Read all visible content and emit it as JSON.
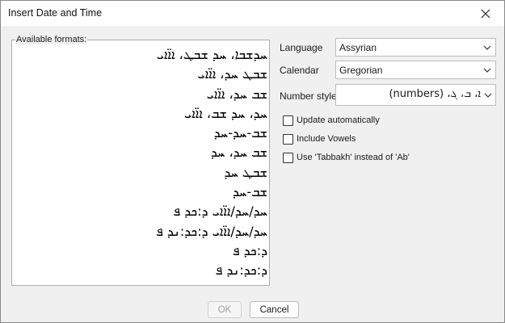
{
  "window": {
    "title": "Insert Date and Time"
  },
  "formats": {
    "label": "Available formats:",
    "items": [
      "ܚܕܫܒܐ، ܚܕ ܫܒܛ، ܐܐ̈ܐܝ",
      "ܫܒܛ ܚܕ، ܐܐ̈ܐܝ",
      "ܫܒ ܚܕ، ܐܐ̈ܐܝ",
      "ܚܕ، ܚܕ ܫܒ، ܐܐ̈ܐܝ",
      "ܫܒ-ܚܕ-ܚܕ",
      "ܫܒ ܚܕ، ܚܕ",
      "ܫܒܛ ܚܕ",
      "ܫܒ-ܚܕ",
      "ܚܕ/ܚܕ/ܐܐ̈ܐܝ ܕ:ܟܕ ܦ",
      "ܚܕ/ܚܕ/ܐܐ̈ܐܝ ܕ:ܟܕ:ܢܕ ܦ",
      "ܕ:ܟܕ ܦ",
      "ܕ:ܟܕ:ܢܕ ܦ"
    ]
  },
  "language": {
    "label": "Language",
    "value": "Assyrian"
  },
  "calendar": {
    "label": "Calendar",
    "value": "Gregorian"
  },
  "number_style": {
    "label": "Number style",
    "value": "ܐ، ܒ، ܓ، (numbers)"
  },
  "options": {
    "update_automatically": {
      "label": "Update automatically",
      "checked": false
    },
    "include_vowels": {
      "label": "Include Vowels",
      "checked": false
    },
    "tabbakh": {
      "label": "Use 'Tabbakh' instead of 'Ab'",
      "checked": false
    }
  },
  "buttons": {
    "ok": "OK",
    "cancel": "Cancel"
  },
  "icons": {
    "close": "close-icon",
    "dropdown": "chevron-down-icon"
  }
}
